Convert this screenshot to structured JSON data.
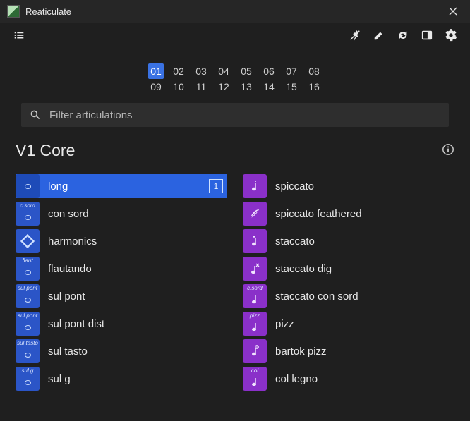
{
  "window": {
    "title": "Reaticulate"
  },
  "filter": {
    "placeholder": "Filter articulations"
  },
  "slots": {
    "row1": [
      "01",
      "02",
      "03",
      "04",
      "05",
      "06",
      "07",
      "08"
    ],
    "row2": [
      "09",
      "10",
      "11",
      "12",
      "13",
      "14",
      "15",
      "16"
    ],
    "active": "01"
  },
  "section": {
    "title": "V1 Core"
  },
  "left": [
    {
      "label": "long",
      "badge_text": "",
      "selected": true,
      "slot": "1"
    },
    {
      "label": "con sord",
      "badge_text": "c.sord"
    },
    {
      "label": "harmonics",
      "badge_text": "",
      "diamond": true
    },
    {
      "label": "flautando",
      "badge_text": "flaut"
    },
    {
      "label": "sul pont",
      "badge_text": "sul pont"
    },
    {
      "label": "sul pont dist",
      "badge_text": "sul pont"
    },
    {
      "label": "sul tasto",
      "badge_text": "sul tasto"
    },
    {
      "label": "sul g",
      "badge_text": "sul g"
    }
  ],
  "right": [
    {
      "label": "spiccato",
      "icon": "spiccato"
    },
    {
      "label": "spiccato feathered",
      "icon": "feather"
    },
    {
      "label": "staccato",
      "icon": "staccato"
    },
    {
      "label": "staccato dig",
      "icon": "staccato-dig"
    },
    {
      "label": "staccato con sord",
      "icon": "c.sord",
      "badge_text": "c.sord"
    },
    {
      "label": "pizz",
      "icon": "pizz",
      "badge_text": "pizz"
    },
    {
      "label": "bartok pizz",
      "icon": "bartok"
    },
    {
      "label": "col legno",
      "icon": "col",
      "badge_text": "col"
    }
  ],
  "colors": {
    "accent_blue": "#2b63e0",
    "badge_blue": "#2b55c7",
    "badge_purple": "#8a30c9",
    "bg": "#1f1f1f"
  }
}
